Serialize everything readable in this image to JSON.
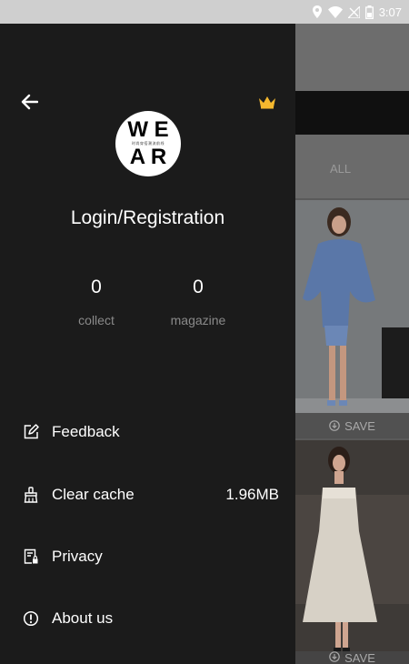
{
  "status_bar": {
    "time": "3:07",
    "icons": [
      "location-icon",
      "wifi-icon",
      "signal-icon",
      "battery-icon"
    ]
  },
  "drawer": {
    "back_icon": "arrow-left-icon",
    "vip_icon": "crown-icon",
    "logo": {
      "line1": "W E",
      "line2": "A R",
      "tagline": "时尚穿搭潮流前线"
    },
    "login_label": "Login/Registration",
    "stats": {
      "collect": {
        "value": "0",
        "label": "collect"
      },
      "magazine": {
        "value": "0",
        "label": "magazine"
      }
    },
    "menu": {
      "feedback": {
        "label": "Feedback",
        "icon": "edit-icon"
      },
      "clear_cache": {
        "label": "Clear cache",
        "value": "1.96MB",
        "icon": "broom-icon"
      },
      "privacy": {
        "label": "Privacy",
        "icon": "document-lock-icon"
      },
      "about": {
        "label": "About us",
        "icon": "info-icon"
      }
    }
  },
  "background": {
    "tab_label": "ALL",
    "save_label": "SAVE",
    "save_label_2": "SAVE"
  },
  "colors": {
    "drawer_bg": "#1b1b1b",
    "crown": "#f5b82e",
    "label_grey": "#8a8a8a",
    "text": "#ffffff"
  }
}
